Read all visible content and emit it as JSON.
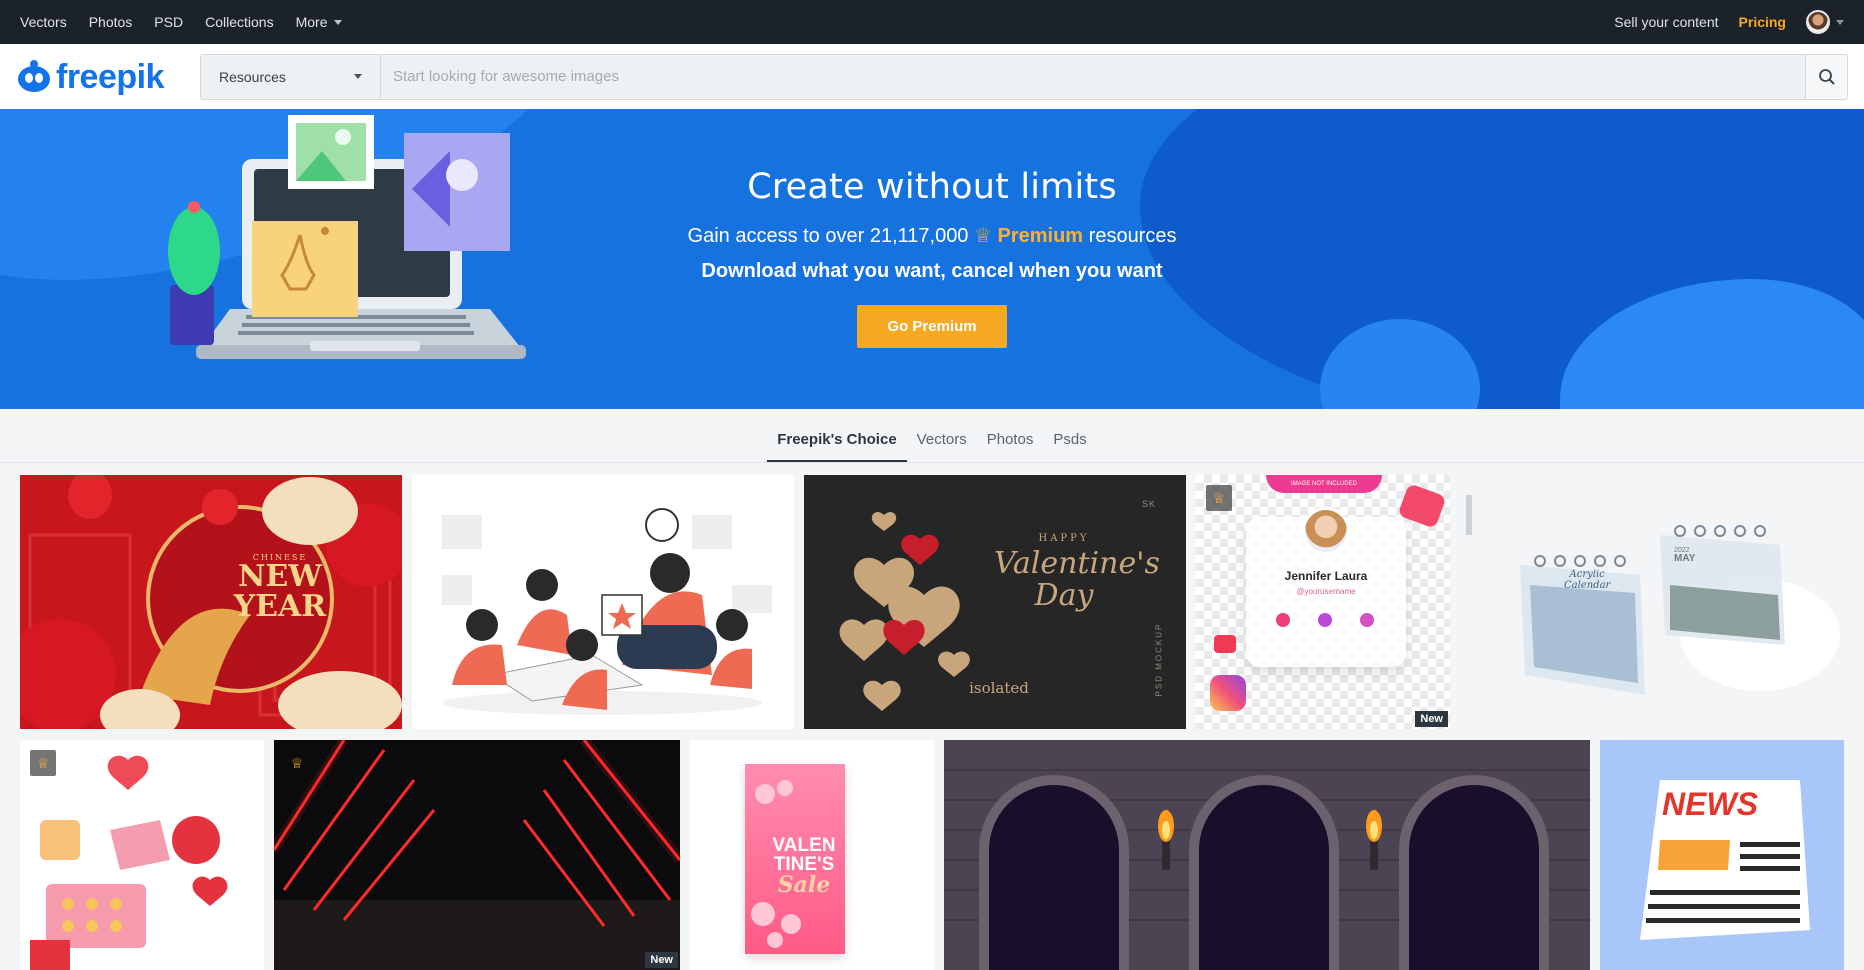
{
  "topbar": {
    "nav": [
      "Vectors",
      "Photos",
      "PSD",
      "Collections",
      "More"
    ],
    "sell": "Sell your content",
    "pricing": "Pricing"
  },
  "logo": {
    "text": "freepik"
  },
  "search": {
    "resources": "Resources",
    "placeholder": "Start looking for awesome images"
  },
  "hero": {
    "title": "Create without limits",
    "line2_prefix": "Gain access to over 21,117,000",
    "line2_premium": "Premium",
    "line2_suffix": "resources",
    "line3": "Download what you want, cancel when you want",
    "button": "Go Premium"
  },
  "tabs": [
    "Freepik's Choice",
    "Vectors",
    "Photos",
    "Psds"
  ],
  "tiles": {
    "newyear": {
      "line1": "CHINESE",
      "line2": "NEW",
      "line3": "YEAR"
    },
    "valentine": {
      "happy": "HAPPY",
      "title1": "Valentine's",
      "title2": "Day",
      "sub": "isolated",
      "side": "PSD MOCKUP",
      "corner": "SK"
    },
    "instagram": {
      "name": "Jennifer Laura",
      "handle": "@yourusername",
      "top": "IMAGE NOT INCLUDED",
      "new": "New"
    },
    "calendar": {
      "text1": "Acrylic",
      "text2": "Calendar",
      "year": "2022",
      "month": "MAY"
    },
    "neon": {
      "new": "New"
    },
    "valsale": {
      "l1": "VALEN",
      "l2": "TINE'S",
      "l3": "Sale"
    },
    "news": {
      "text": "NEWS"
    }
  },
  "colors": {
    "topbar": "#1b2229",
    "brand": "#1273eb",
    "accent": "#f7a823",
    "hero": "#1572df"
  }
}
